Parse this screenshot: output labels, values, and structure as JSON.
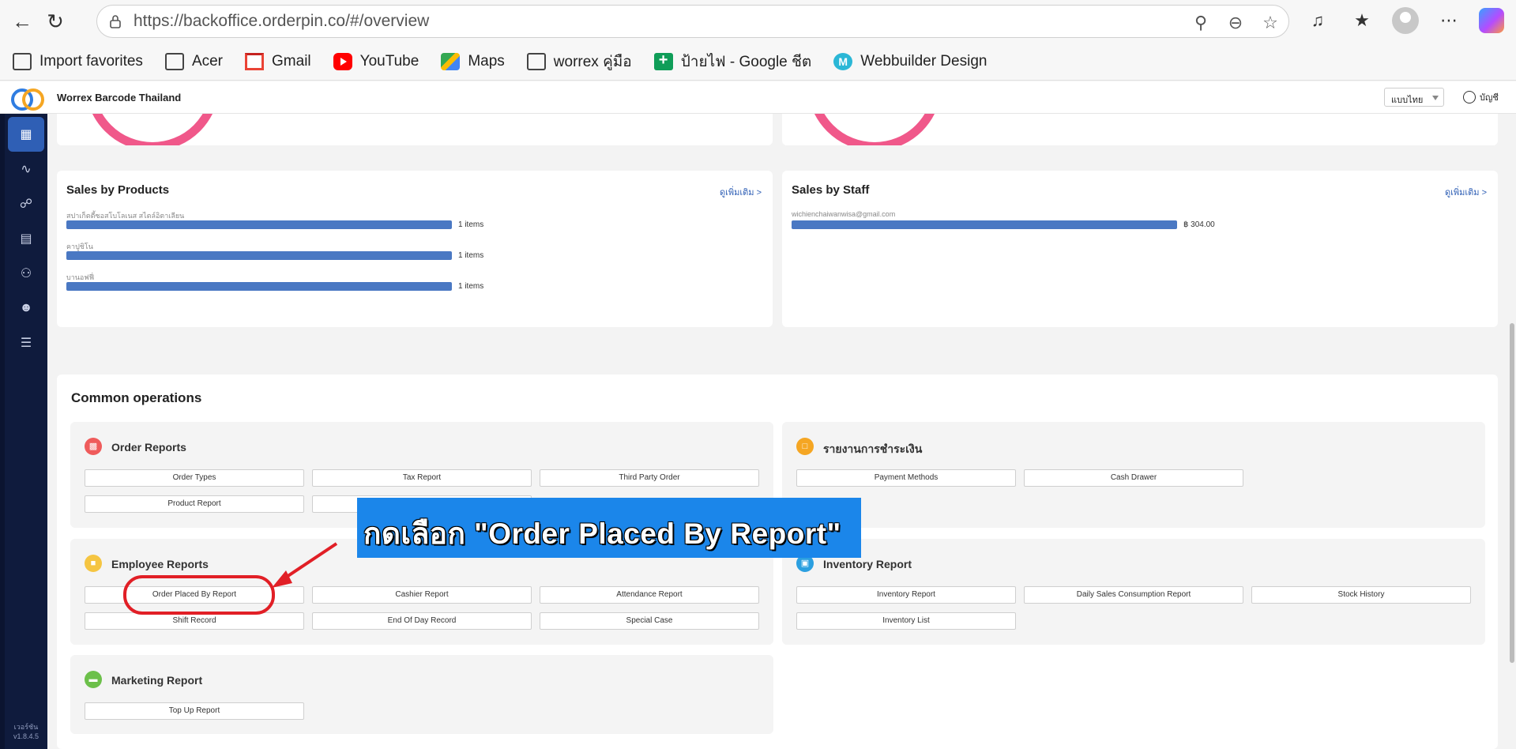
{
  "browser": {
    "url": "https://backoffice.orderpin.co/#/overview",
    "bookmarks": [
      "Import favorites",
      "Acer",
      "Gmail",
      "YouTube",
      "Maps",
      "worrex คู่มือ",
      "ป้ายไฟ - Google ชีต",
      "Webbuilder Design"
    ]
  },
  "app": {
    "store_name": "Worrex Barcode Thailand",
    "language": "แบบไทย",
    "account": "บัญชี",
    "version": [
      "เวอร์ชัน",
      "v1.8.4.5"
    ]
  },
  "sales_products": {
    "title": "Sales by Products",
    "more": "ดูเพิ่มเติม >",
    "items": [
      {
        "label": "สปาเก็ตตี้ซอสโบโลเนส สไตล์อิตาเลียน",
        "value": "1 items"
      },
      {
        "label": "คาปูชิโน",
        "value": "1 items"
      },
      {
        "label": "บานอฟฟี่",
        "value": "1 items"
      }
    ]
  },
  "sales_staff": {
    "title": "Sales by Staff",
    "more": "ดูเพิ่มเติม >",
    "items": [
      {
        "label": "wichienchaiwanwisa@gmail.com",
        "value": "฿ 304.00"
      }
    ]
  },
  "common": {
    "title": "Common operations",
    "order_reports": {
      "title": "Order Reports",
      "buttons": [
        "Order Types",
        "Tax Report",
        "Third Party Order",
        "Product Report"
      ]
    },
    "payment_reports": {
      "title": "รายงานการชำระเงิน",
      "buttons": [
        "Payment Methods",
        "Cash Drawer"
      ]
    },
    "employee_reports": {
      "title": "Employee Reports",
      "buttons": [
        "Order Placed By Report",
        "Cashier Report",
        "Attendance Report",
        "Shift Record",
        "End Of Day Record",
        "Special Case"
      ]
    },
    "inventory_reports": {
      "title": "Inventory Report",
      "buttons": [
        "Inventory Report",
        "Daily Sales Consumption Report",
        "Stock History",
        "Inventory List"
      ]
    },
    "marketing_reports": {
      "title": "Marketing Report",
      "buttons": [
        "Top Up Report"
      ]
    }
  },
  "annotation": {
    "callout": "กดเลือก \"Order Placed By Report\""
  },
  "colors": {
    "accent": "#2f5fb5",
    "bar": "#4a78c3",
    "ring": "#f0588a",
    "annotation": "#e11f26",
    "callout_bg": "#1b86ea"
  }
}
